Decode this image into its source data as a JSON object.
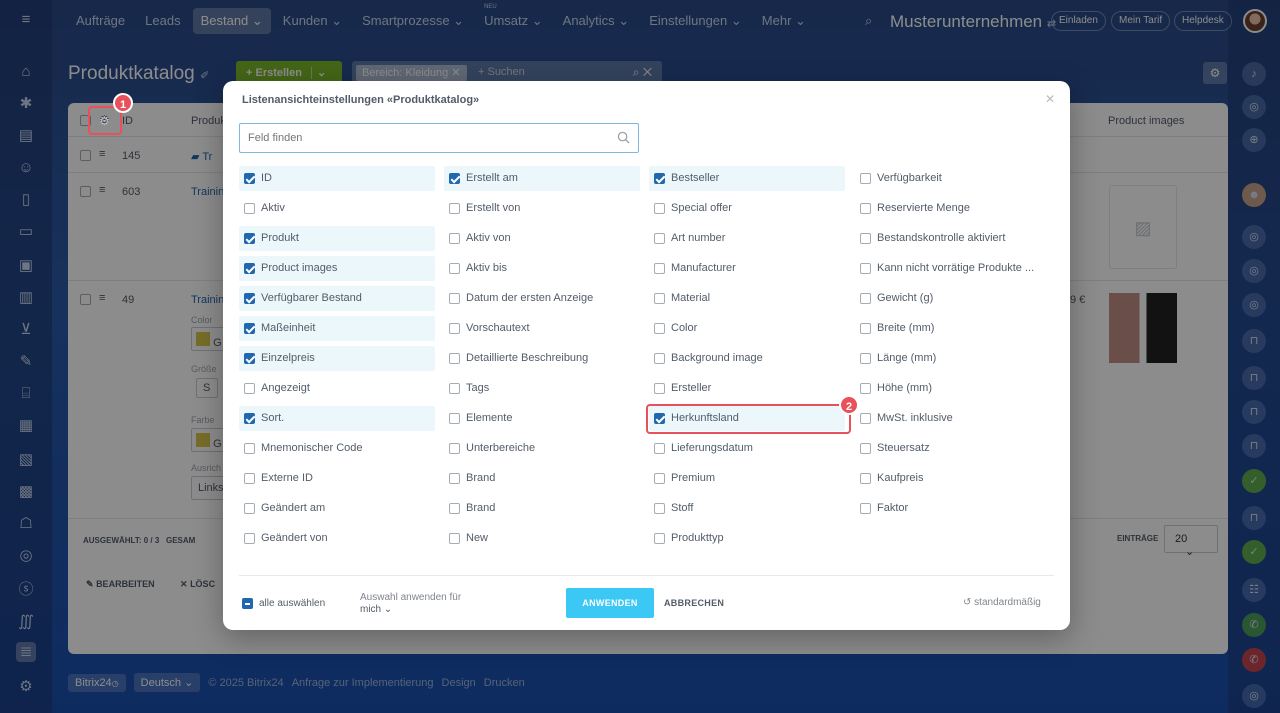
{
  "topnav": {
    "items": [
      "Aufträge",
      "Leads",
      "Bestand",
      "Kunden",
      "Smartprozesse",
      "Umsatz",
      "Analytics",
      "Einstellungen",
      "Mehr"
    ],
    "new_badge": "NEU",
    "company": "Musterunternehmen",
    "buttons": [
      "Einladen",
      "Mein Tarif",
      "Helpdesk"
    ]
  },
  "page": {
    "title": "Produktkatalog",
    "create_label": "+ Erstellen",
    "filter_tag": "Bereich: Kleidung",
    "search_placeholder": "+ Suchen"
  },
  "background_grid": {
    "header": {
      "id": "ID",
      "product": "Produkt",
      "images": "Product images"
    },
    "rows": [
      {
        "id": "145",
        "name": "Tr"
      },
      {
        "id": "603",
        "name": "Trainin"
      },
      {
        "id": "49",
        "name": "Trainin"
      }
    ],
    "fragments": [
      "Color",
      "Größe",
      "S",
      "Farbe",
      "Ausrich",
      "Links",
      "G",
      "G",
      "9 €"
    ],
    "footer": {
      "selected_label": "AUSGEWÄHLT:",
      "selected_value": "0 / 3",
      "total": "GESAM",
      "entries_label": "EINTRÄGE",
      "entries_value": "20",
      "edit": "BEARBEITEN",
      "delete": "LÖSC"
    }
  },
  "annotations": {
    "marker1": "1",
    "marker2": "2"
  },
  "modal": {
    "title": "Listenansichteinstellungen «Produktkatalog»",
    "search_placeholder": "Feld finden",
    "columns": [
      [
        {
          "label": "ID",
          "checked": true
        },
        {
          "label": "Aktiv",
          "checked": false
        },
        {
          "label": "Produkt",
          "checked": true
        },
        {
          "label": "Product images",
          "checked": true
        },
        {
          "label": "Verfügbarer Bestand",
          "checked": true
        },
        {
          "label": "Maßeinheit",
          "checked": true
        },
        {
          "label": "Einzelpreis",
          "checked": true
        },
        {
          "label": "Angezeigt",
          "checked": false
        },
        {
          "label": "Sort.",
          "checked": true
        },
        {
          "label": "Mnemonischer Code",
          "checked": false
        },
        {
          "label": "Externe ID",
          "checked": false
        },
        {
          "label": "Geändert am",
          "checked": false
        },
        {
          "label": "Geändert von",
          "checked": false
        }
      ],
      [
        {
          "label": "Erstellt am",
          "checked": true
        },
        {
          "label": "Erstellt von",
          "checked": false
        },
        {
          "label": "Aktiv von",
          "checked": false
        },
        {
          "label": "Aktiv bis",
          "checked": false
        },
        {
          "label": "Datum der ersten Anzeige",
          "checked": false
        },
        {
          "label": "Vorschautext",
          "checked": false
        },
        {
          "label": "Detaillierte Beschreibung",
          "checked": false
        },
        {
          "label": "Tags",
          "checked": false
        },
        {
          "label": "Elemente",
          "checked": false
        },
        {
          "label": "Unterbereiche",
          "checked": false
        },
        {
          "label": "Brand",
          "checked": false
        },
        {
          "label": "Brand",
          "checked": false
        },
        {
          "label": "New",
          "checked": false
        }
      ],
      [
        {
          "label": "Bestseller",
          "checked": true
        },
        {
          "label": "Special offer",
          "checked": false
        },
        {
          "label": "Art number",
          "checked": false
        },
        {
          "label": "Manufacturer",
          "checked": false
        },
        {
          "label": "Material",
          "checked": false
        },
        {
          "label": "Color",
          "checked": false
        },
        {
          "label": "Background image",
          "checked": false
        },
        {
          "label": "Ersteller",
          "checked": false
        },
        {
          "label": "Herkunftsland",
          "checked": true
        },
        {
          "label": "Lieferungsdatum",
          "checked": false
        },
        {
          "label": "Premium",
          "checked": false
        },
        {
          "label": "Stoff",
          "checked": false
        },
        {
          "label": "Produkttyp",
          "checked": false
        }
      ],
      [
        {
          "label": "Verfügbarkeit",
          "checked": false
        },
        {
          "label": "Reservierte Menge",
          "checked": false
        },
        {
          "label": "Bestandskontrolle aktiviert",
          "checked": false
        },
        {
          "label": "Kann nicht vorrätige Produkte ...",
          "checked": false
        },
        {
          "label": "Gewicht (g)",
          "checked": false
        },
        {
          "label": "Breite (mm)",
          "checked": false
        },
        {
          "label": "Länge (mm)",
          "checked": false
        },
        {
          "label": "Höhe (mm)",
          "checked": false
        },
        {
          "label": "MwSt. inklusive",
          "checked": false
        },
        {
          "label": "Steuersatz",
          "checked": false
        },
        {
          "label": "Kaufpreis",
          "checked": false
        },
        {
          "label": "Faktor",
          "checked": false
        }
      ]
    ],
    "select_all": "alle auswählen",
    "apply_for_label": "Auswahl anwenden für",
    "apply_for_value": "mich",
    "apply": "ANWENDEN",
    "cancel": "ABBRECHEN",
    "default": "standardmäßig"
  },
  "footer": {
    "brand": "Bitrix24",
    "language": "Deutsch",
    "copyright": "© 2025 Bitrix24",
    "links": [
      "Anfrage zur Implementierung",
      "Design",
      "Drucken"
    ]
  },
  "colors": {
    "accent": "#3bc8f5",
    "check": "#2067b0",
    "marker": "#e8505b",
    "create": "#7dbb2b"
  }
}
